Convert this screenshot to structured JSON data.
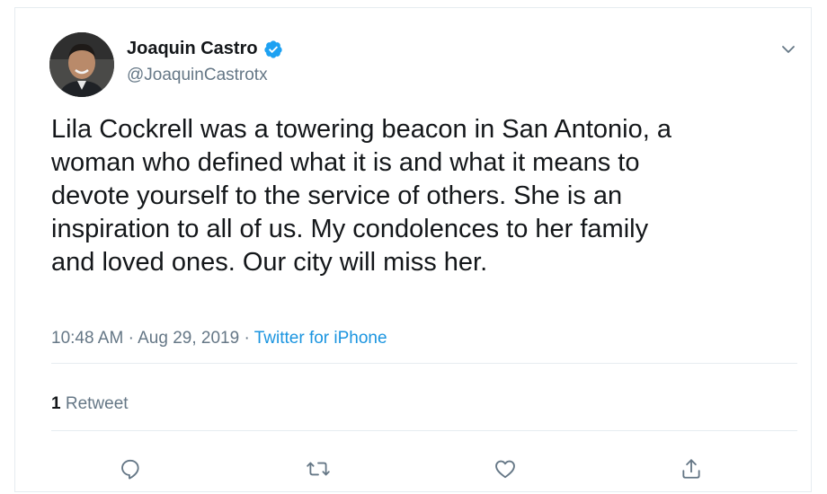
{
  "tweet": {
    "author": {
      "name": "Joaquin Castro",
      "handle": "@JoaquinCastrotx",
      "verified": true
    },
    "text": "Lila Cockrell was a towering beacon in San Antonio, a\nwoman who defined what it is and what it means to\ndevote yourself to the service of others. She is an\ninspiration to all of us. My condolences to her family\nand loved ones. Our city will miss her.",
    "time": "10:48 AM",
    "date": "Aug 29, 2019",
    "separator": "·",
    "source": "Twitter for iPhone",
    "retweet_count": "1",
    "retweet_label": "Retweet"
  },
  "icons": {
    "verified": "verified-badge-icon",
    "more": "chevron-down-icon",
    "reply": "reply-icon",
    "retweet": "retweet-icon",
    "like": "heart-icon",
    "share": "share-icon"
  },
  "colors": {
    "text": "#14171a",
    "secondary": "#657786",
    "link": "#1b95e0",
    "verified": "#1da1f2",
    "border": "#e6ecf0"
  }
}
